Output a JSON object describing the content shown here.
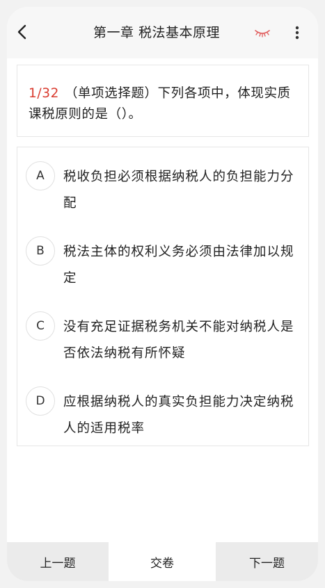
{
  "header": {
    "title": "第一章 税法基本原理",
    "back_icon": "back-arrow-icon",
    "eye_icon": "closed-eye-icon",
    "more_icon": "more-vertical-icon",
    "eye_color": "#e05a5a"
  },
  "question": {
    "number": "1/32",
    "text": "（单项选择题）下列各项中，体现实质课税原则的是（）。",
    "number_color": "#d93a2e"
  },
  "options": [
    {
      "letter": "A",
      "text": "税收负担必须根据纳税人的负担能力分配"
    },
    {
      "letter": "B",
      "text": "税法主体的权利义务必须由法律加以规定"
    },
    {
      "letter": "C",
      "text": "没有充足证据税务机关不能对纳税人是否依法纳税有所怀疑"
    },
    {
      "letter": "D",
      "text": "应根据纳税人的真实负担能力决定纳税人的适用税率"
    }
  ],
  "footer": {
    "prev_label": "上一题",
    "submit_label": "交卷",
    "next_label": "下一题"
  }
}
